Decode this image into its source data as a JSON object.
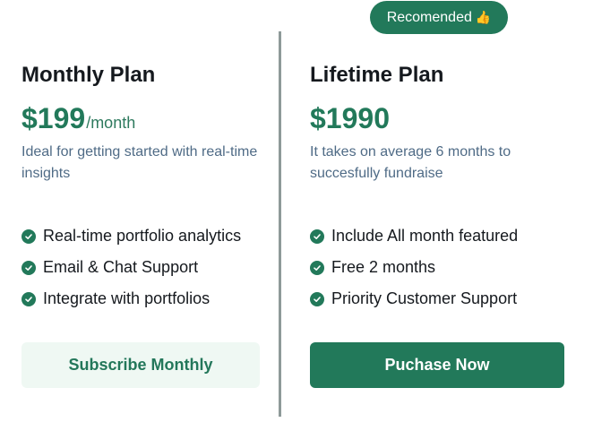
{
  "badge": {
    "label": "Recomended",
    "emoji": "👍"
  },
  "monthly": {
    "title": "Monthly Plan",
    "price": "$199",
    "period": "/month",
    "description": "Ideal for getting started with real-time insights",
    "features": [
      "Real-time portfolio analytics",
      "Email & Chat Support",
      "Integrate with portfolios"
    ],
    "button_label": "Subscribe Monthly"
  },
  "lifetime": {
    "title": "Lifetime Plan",
    "price": "$1990",
    "description": "It takes on average 6 months to succesfully fundraise",
    "features": [
      "Include All month featured",
      "Free 2 months",
      "Priority Customer Support"
    ],
    "button_label": "Puchase Now"
  },
  "colors": {
    "accent": "#22795a",
    "accent_light_bg": "#eff8f3",
    "divider": "#8e9a99",
    "muted_text": "#4f6b86"
  }
}
